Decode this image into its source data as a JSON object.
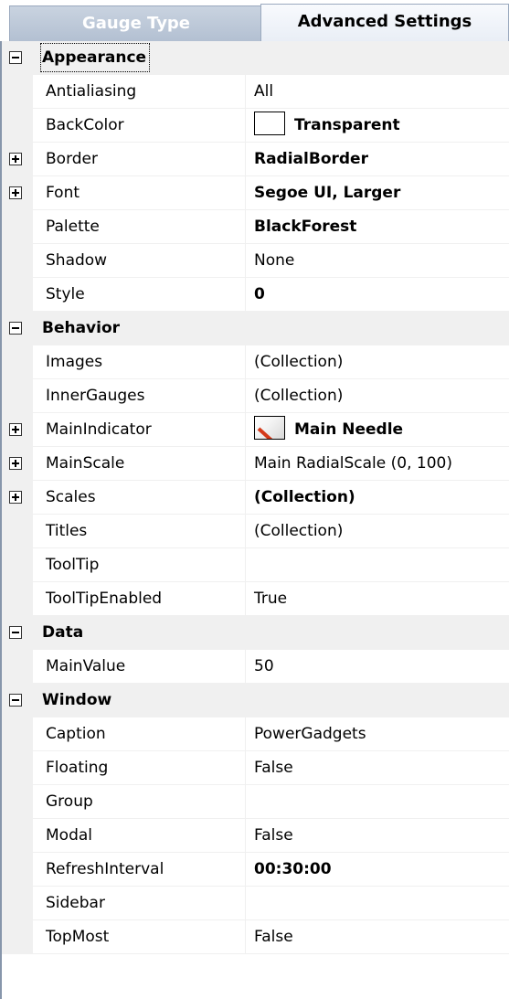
{
  "tabs": {
    "gauge_type": "Gauge Type",
    "advanced_settings": "Advanced Settings"
  },
  "categories": [
    {
      "name": "Appearance",
      "properties": [
        {
          "name": "Antialiasing",
          "value": "All",
          "bold": false,
          "expandable": false
        },
        {
          "name": "BackColor",
          "value": "Transparent",
          "bold": true,
          "expandable": false,
          "swatch": "color-swatch"
        },
        {
          "name": "Border",
          "value": "RadialBorder",
          "bold": true,
          "expandable": true
        },
        {
          "name": "Font",
          "value": "Segoe UI, Larger",
          "bold": true,
          "expandable": true
        },
        {
          "name": "Palette",
          "value": "BlackForest",
          "bold": true,
          "expandable": false
        },
        {
          "name": "Shadow",
          "value": "None",
          "bold": false,
          "expandable": false
        },
        {
          "name": "Style",
          "value": "0",
          "bold": true,
          "expandable": false
        }
      ]
    },
    {
      "name": "Behavior",
      "properties": [
        {
          "name": "Images",
          "value": "(Collection)",
          "bold": false,
          "expandable": false
        },
        {
          "name": "InnerGauges",
          "value": "(Collection)",
          "bold": false,
          "expandable": false
        },
        {
          "name": "MainIndicator",
          "value": "Main Needle",
          "bold": true,
          "expandable": true,
          "swatch": "needle-icon"
        },
        {
          "name": "MainScale",
          "value": "Main RadialScale (0, 100)",
          "bold": false,
          "expandable": true
        },
        {
          "name": "Scales",
          "value": "(Collection)",
          "bold": true,
          "expandable": true
        },
        {
          "name": "Titles",
          "value": "(Collection)",
          "bold": false,
          "expandable": false
        },
        {
          "name": "ToolTip",
          "value": "",
          "bold": false,
          "expandable": false
        },
        {
          "name": "ToolTipEnabled",
          "value": "True",
          "bold": false,
          "expandable": false
        }
      ]
    },
    {
      "name": "Data",
      "properties": [
        {
          "name": "MainValue",
          "value": "50",
          "bold": false,
          "expandable": false
        }
      ]
    },
    {
      "name": "Window",
      "properties": [
        {
          "name": "Caption",
          "value": "PowerGadgets",
          "bold": false,
          "expandable": false
        },
        {
          "name": "Floating",
          "value": "False",
          "bold": false,
          "expandable": false
        },
        {
          "name": "Group",
          "value": "",
          "bold": false,
          "expandable": false
        },
        {
          "name": "Modal",
          "value": "False",
          "bold": false,
          "expandable": false
        },
        {
          "name": "RefreshInterval",
          "value": "00:30:00",
          "bold": true,
          "expandable": false
        },
        {
          "name": "Sidebar",
          "value": "",
          "bold": false,
          "expandable": false
        },
        {
          "name": "TopMost",
          "value": "False",
          "bold": false,
          "expandable": false
        }
      ]
    }
  ],
  "colors": {
    "gutter": "#f0f0f0",
    "grid_line": "#f0f0f0",
    "needle": "#d43a1a"
  }
}
